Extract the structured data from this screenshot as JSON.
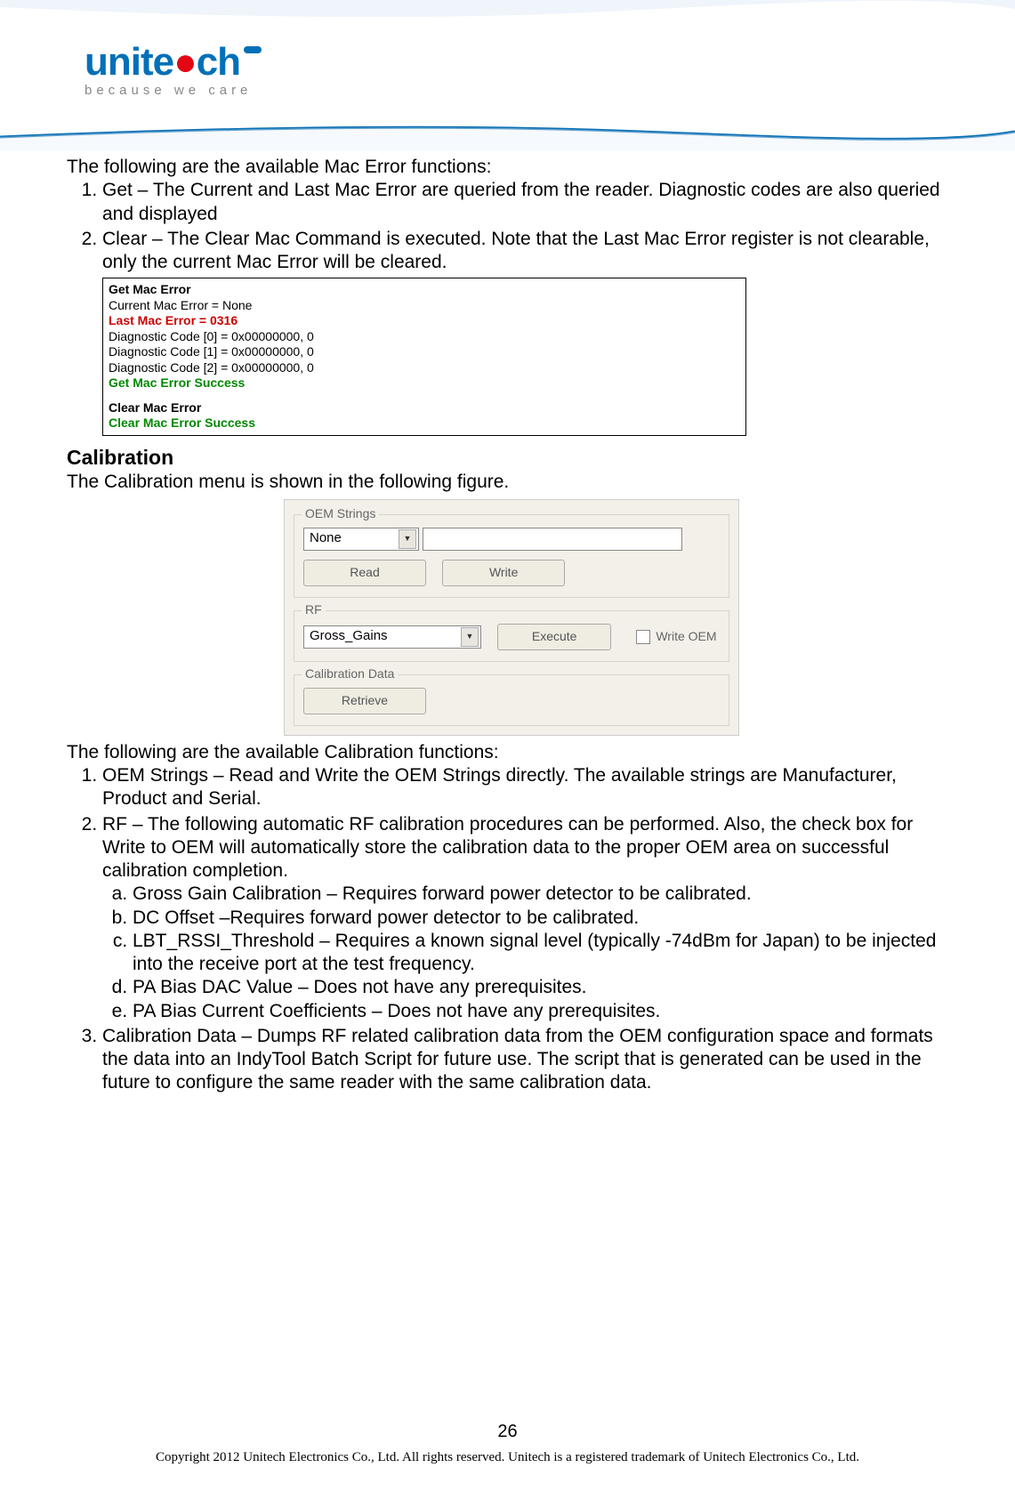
{
  "logo": {
    "brand_prefix": "unite",
    "brand_suffix": "ch",
    "tagline": "because we care"
  },
  "intro": "The following are the available Mac Error functions:",
  "list1": {
    "item1": "Get – The Current and Last Mac Error are queried from the reader. Diagnostic codes are also queried and displayed",
    "item2": "Clear – The Clear Mac Command is executed. Note that the Last Mac Error register is not clearable, only the current Mac Error will be cleared."
  },
  "codebox": {
    "l1": "Get Mac Error",
    "l2": "Current Mac Error = None",
    "l3": "Last Mac Error = 0316",
    "l4": "Diagnostic Code [0] = 0x00000000, 0",
    "l5": "Diagnostic Code [1] = 0x00000000, 0",
    "l6": "Diagnostic Code [2] = 0x00000000, 0",
    "l7": "Get Mac Error Success",
    "l8": "Clear Mac Error",
    "l9": "Clear Mac Error Success"
  },
  "calibration": {
    "heading": "Calibration",
    "text": "The Calibration menu is shown in the following figure."
  },
  "ui": {
    "oem_legend": "OEM Strings",
    "oem_select": "None",
    "read_btn": "Read",
    "write_btn": "Write",
    "rf_legend": "RF",
    "rf_select": "Gross_Gains",
    "execute_btn": "Execute",
    "write_oem_check": "Write OEM",
    "caldata_legend": "Calibration Data",
    "retrieve_btn": "Retrieve"
  },
  "calib_intro": "The following are the available Calibration functions:",
  "list2": {
    "item1": "OEM Strings – Read and Write the OEM Strings directly. The available strings are Manufacturer, Product and Serial.",
    "item2": "RF – The following automatic RF calibration procedures can be performed. Also, the check box for Write to OEM will automatically store the calibration data to the proper OEM area on successful calibration completion.",
    "sub": {
      "a": "Gross Gain Calibration – Requires forward power detector to be calibrated.",
      "b": "DC Offset –Requires forward power detector to be calibrated.",
      "c": "LBT_RSSI_Threshold – Requires a known signal level (typically -74dBm for Japan) to be injected into the receive port at the test frequency.",
      "d": "PA Bias DAC Value – Does not have any prerequisites.",
      "e": "PA Bias Current Coefficients – Does not have any prerequisites."
    },
    "item3": "Calibration Data – Dumps RF related calibration data from the OEM configuration space and formats the data into an IndyTool Batch Script for future use. The script that is generated can be used in the future to configure the same reader with the same calibration data."
  },
  "page_num": "26",
  "footer": "Copyright 2012 Unitech Electronics Co., Ltd. All rights reserved. Unitech is a registered trademark of Unitech Electronics Co., Ltd."
}
